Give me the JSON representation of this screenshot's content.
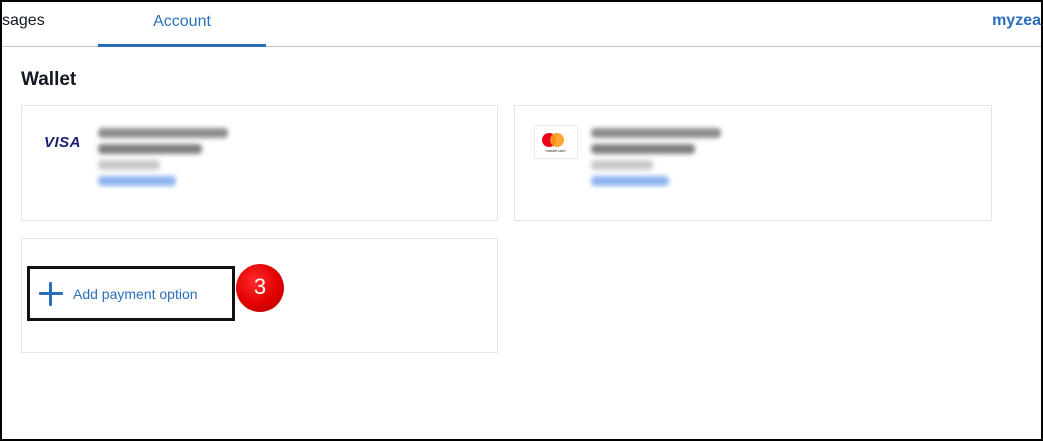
{
  "tabs": {
    "messages_label": "sages",
    "account_label": "Account"
  },
  "user": {
    "link_label": "myzea"
  },
  "wallet": {
    "title": "Wallet",
    "cards": [
      {
        "brand": "VISA",
        "brand_icon": "visa-logo"
      },
      {
        "brand": "mastercard",
        "brand_icon": "mastercard-logo"
      }
    ],
    "add_payment_label": "Add payment option",
    "add_icon": "plus-icon"
  },
  "annotation": {
    "step_number": "3",
    "color": "#e00000"
  },
  "colors": {
    "accent": "#2a6ebb",
    "text": "#111820"
  }
}
